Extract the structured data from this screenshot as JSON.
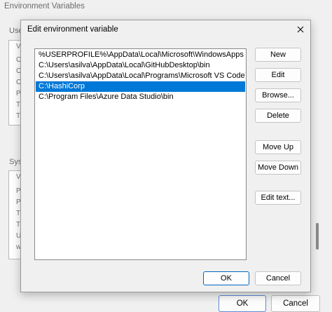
{
  "background_window": {
    "title": "Environment Variables",
    "user_group_label": "User",
    "system_group_label": "Syste",
    "user_list_header": "Va",
    "user_list_rows": [
      "On",
      "On",
      "On",
      "Pa",
      "TE",
      "TM"
    ],
    "system_list_header": "Va",
    "system_list_rows": [
      "PR",
      "PS",
      "TE",
      "TM",
      "US",
      "wi"
    ],
    "ok_label": "OK",
    "cancel_label": "Cancel"
  },
  "dialog": {
    "title": "Edit environment variable",
    "close_icon": "close-icon",
    "paths": [
      "%USERPROFILE%\\AppData\\Local\\Microsoft\\WindowsApps",
      "C:\\Users\\asilva\\AppData\\Local\\GitHubDesktop\\bin",
      "C:\\Users\\asilva\\AppData\\Local\\Programs\\Microsoft VS Code\\bin",
      "C:\\HashiCorp",
      "C:\\Program Files\\Azure Data Studio\\bin"
    ],
    "selected_index": 3,
    "buttons": {
      "new": "New",
      "edit": "Edit",
      "browse": "Browse...",
      "delete": "Delete",
      "move_up": "Move Up",
      "move_down": "Move Down",
      "edit_text": "Edit text..."
    },
    "ok_label": "OK",
    "cancel_label": "Cancel"
  },
  "colors": {
    "selection": "#0078d7",
    "accent_border": "#0067c0"
  }
}
